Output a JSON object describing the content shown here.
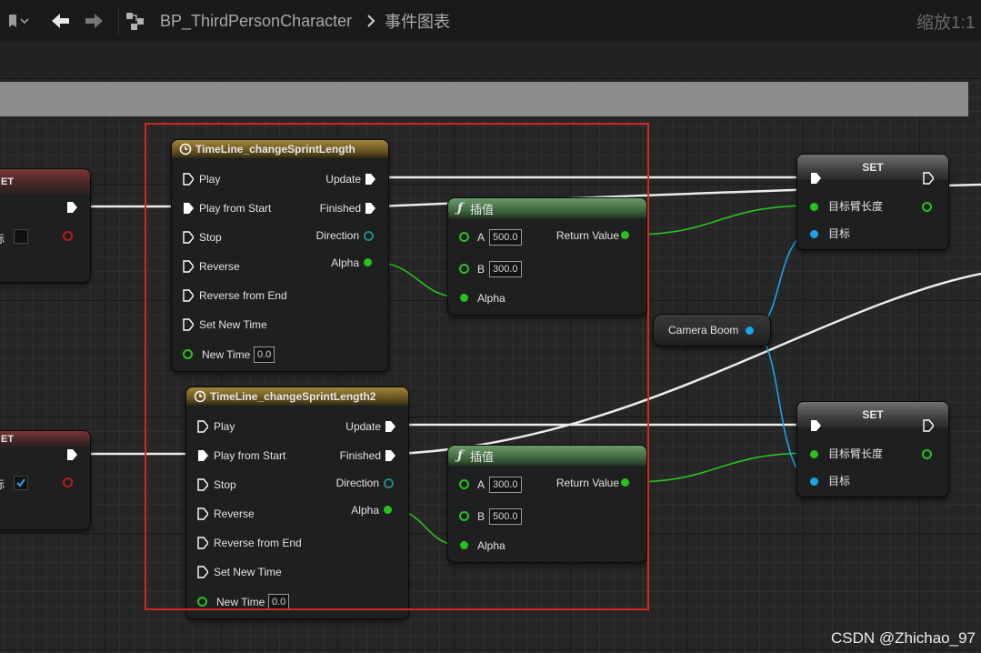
{
  "toolbar": {
    "breadcrumb_blueprint": "BP_ThirdPersonCharacter",
    "breadcrumb_graph": "事件图表",
    "zoom": "缩放1:1"
  },
  "timeline1": {
    "title": "TimeLine_changeSprintLength",
    "inputs": [
      "Play",
      "Play from Start",
      "Stop",
      "Reverse",
      "Reverse from End",
      "Set New Time"
    ],
    "new_time_label": "New Time",
    "new_time_value": "0.0",
    "outputs": {
      "update": "Update",
      "finished": "Finished",
      "direction": "Direction",
      "alpha": "Alpha"
    }
  },
  "timeline2": {
    "title": "TimeLine_changeSprintLength2",
    "inputs": [
      "Play",
      "Play from Start",
      "Stop",
      "Reverse",
      "Reverse from End",
      "Set New Time"
    ],
    "new_time_label": "New Time",
    "new_time_value": "0.0",
    "outputs": {
      "update": "Update",
      "finished": "Finished",
      "direction": "Direction",
      "alpha": "Alpha"
    }
  },
  "lerp1": {
    "title": "插值",
    "a_label": "A",
    "a_value": "500.0",
    "b_label": "B",
    "b_value": "300.0",
    "alpha_label": "Alpha",
    "return_label": "Return Value"
  },
  "lerp2": {
    "title": "插值",
    "a_label": "A",
    "a_value": "300.0",
    "b_label": "B",
    "b_value": "500.0",
    "alpha_label": "Alpha",
    "return_label": "Return Value"
  },
  "set1": {
    "title": "SET",
    "arm_label": "目标臂长度",
    "target_label": "目标"
  },
  "set2": {
    "title": "SET",
    "arm_label": "目标臂长度",
    "target_label": "目标"
  },
  "camera_boom": {
    "label": "Camera Boom"
  },
  "left_node1": {
    "title": "ET",
    "pin_label": "标"
  },
  "left_node2": {
    "title": "ET",
    "pin_label": "标"
  },
  "watermark": "CSDN @Zhichao_97",
  "colors": {
    "exec": "#ffffff",
    "float_pin": "#27c21e",
    "object_pin": "#1ba3e8",
    "timeline_header": "#8a6f2e",
    "function_header": "#4f7d4f",
    "selection": "#d22a1f"
  }
}
